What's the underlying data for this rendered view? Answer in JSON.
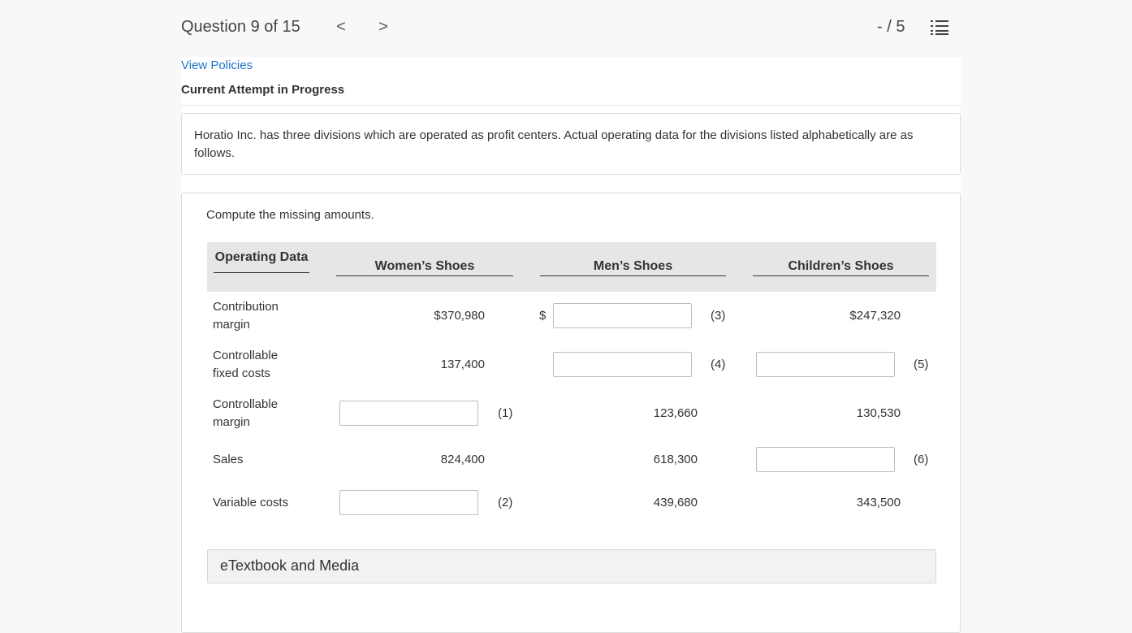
{
  "header": {
    "question_label": "Question 9 of 15",
    "prev_arrow": "<",
    "next_arrow": ">",
    "score": "- / 5",
    "list_icon": "list-icon"
  },
  "links": {
    "view_policies": "View Policies"
  },
  "status": {
    "attempt": "Current Attempt in Progress"
  },
  "problem": {
    "text": "Horatio Inc. has three divisions which are operated as profit centers. Actual operating data for the divisions listed alphabetically are as follows."
  },
  "work": {
    "instruction": "Compute the missing amounts.",
    "headers": {
      "operating_data": "Operating Data",
      "womens": "Women’s Shoes",
      "mens": "Men’s Shoes",
      "childrens": "Children’s Shoes"
    },
    "rows": [
      {
        "label": "Contribution margin",
        "womens": "$370,980",
        "mens_prefix": "$",
        "mens_input": "",
        "mens_ref": "(3)",
        "childrens": "$247,320"
      },
      {
        "label": "Controllable fixed costs",
        "womens": "137,400",
        "mens_input": "",
        "mens_ref": "(4)",
        "childrens_input": "",
        "childrens_ref": "(5)"
      },
      {
        "label": "Controllable margin",
        "womens_input": "",
        "womens_ref": "(1)",
        "mens": "123,660",
        "childrens": "130,530"
      },
      {
        "label": "Sales",
        "womens": "824,400",
        "mens": "618,300",
        "childrens_input": "",
        "childrens_ref": "(6)"
      },
      {
        "label": "Variable costs",
        "womens_input": "",
        "womens_ref": "(2)",
        "mens": "439,680",
        "childrens": "343,500"
      }
    ],
    "etextbook": "eTextbook and Media"
  }
}
